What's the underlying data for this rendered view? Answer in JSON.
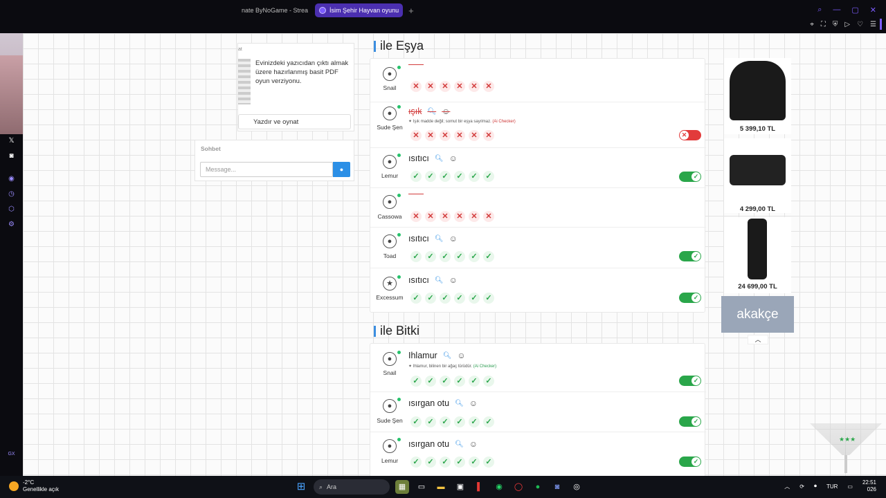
{
  "browser": {
    "tabs": [
      {
        "label": "nate ByNoGame - Strea",
        "active": false
      },
      {
        "label": "İsim Şehir Hayvan oyunu",
        "active": true
      }
    ],
    "new_tab": "+"
  },
  "print_card": {
    "cut_label": "at",
    "description": "Evinizdeki yazıcıdan çıktı almak üzere hazırlanmış basit PDF oyun verziyonu.",
    "button_label": "Yazdır ve oynat"
  },
  "chat": {
    "title": "Sohbet",
    "placeholder": "Message..."
  },
  "sections": [
    {
      "title": "ile Eşya",
      "rows": [
        {
          "player": "Snail",
          "answer": "",
          "status": "empty",
          "marks": [
            "x",
            "x",
            "x",
            "x",
            "x",
            "x"
          ],
          "toggle": null
        },
        {
          "player": "Sude Şen",
          "answer": "ışık",
          "status": "wrong",
          "note": "Işık madde değil; somut bir eşya sayılmaz.",
          "note_tag": "(Ai Checker)",
          "marks": [
            "x",
            "x",
            "x",
            "x",
            "x",
            "x"
          ],
          "toggle": "off"
        },
        {
          "player": "Lemur",
          "answer": "ısıtıcı",
          "status": "ok",
          "marks": [
            "v",
            "v",
            "v",
            "v",
            "v",
            "v"
          ],
          "toggle": "on"
        },
        {
          "player": "Cassowa",
          "answer": "",
          "status": "empty",
          "marks": [
            "x",
            "x",
            "x",
            "x",
            "x",
            "x"
          ],
          "toggle": null
        },
        {
          "player": "Toad",
          "answer": "ısıtıcı",
          "status": "ok",
          "marks": [
            "v",
            "v",
            "v",
            "v",
            "v",
            "v"
          ],
          "toggle": "on"
        },
        {
          "player": "Excessum",
          "answer": "ısıtıcı",
          "status": "ok",
          "marks": [
            "v",
            "v",
            "v",
            "v",
            "v",
            "v"
          ],
          "toggle": "on"
        }
      ]
    },
    {
      "title": "ile Bitki",
      "rows": [
        {
          "player": "Snail",
          "answer": "Ihlamur",
          "status": "ok",
          "note": "Ihlamur, bilinen bir ağaç türüdür.",
          "note_tag": "(Ai Checker)",
          "marks": [
            "v",
            "v",
            "v",
            "v",
            "v",
            "v"
          ],
          "toggle": "on"
        },
        {
          "player": "Sude Şen",
          "answer": "ısırgan otu",
          "status": "ok",
          "marks": [
            "v",
            "v",
            "v",
            "v",
            "v",
            "v"
          ],
          "toggle": "on"
        },
        {
          "player": "Lemur",
          "answer": "ısırgan otu",
          "status": "ok",
          "marks": [
            "v",
            "v",
            "v",
            "v",
            "v",
            "v"
          ],
          "toggle": "on"
        }
      ]
    }
  ],
  "products": [
    {
      "price": "5 399,10 TL",
      "image": "webcam"
    },
    {
      "price": "4 299,00 TL",
      "image": "conference-camera"
    },
    {
      "price": "24 699,00 TL",
      "image": "pocket-gimbal-camera"
    }
  ],
  "ad_brand": "akakçe",
  "taskbar": {
    "temperature": "-2°C",
    "weather": "Genellikle açık",
    "search": "Ara",
    "lang": "TUR",
    "time": "22:51",
    "date": "026"
  },
  "sidebar_icons": [
    "x-icon",
    "discord-icon",
    "circle-icon",
    "clock-icon",
    "cube-icon",
    "gear-icon"
  ],
  "sidebar_footer": "GX"
}
